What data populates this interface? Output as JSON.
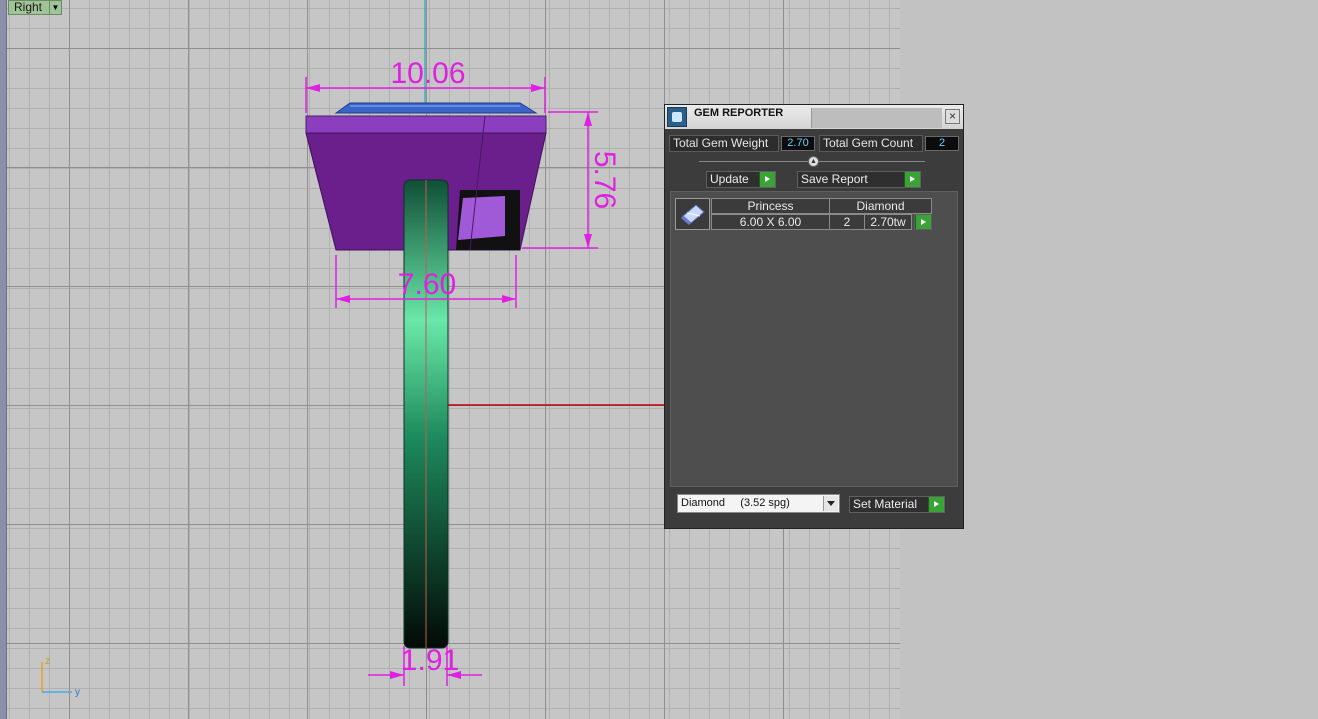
{
  "viewport": {
    "label": "Right",
    "dimensions": {
      "top_width": "10.06",
      "height": "5.76",
      "base_width": "7.60",
      "band_width": "1.91"
    },
    "axes": {
      "vertical": "z",
      "horizontal": "y"
    }
  },
  "gem_reporter": {
    "title": "GEM REPORTER",
    "close": "×",
    "total_weight_label": "Total Gem Weight",
    "total_weight_value": "2.70",
    "total_count_label": "Total Gem Count",
    "total_count_value": "2",
    "update_button": "Update",
    "save_button": "Save Report",
    "gems": [
      {
        "shape": "Princess",
        "material": "Diamond",
        "size": "6.00 X 6.00",
        "count": "2",
        "weight": "2.70tw"
      }
    ],
    "material_select": "Diamond     (3.52 spg)",
    "set_material_button": "Set Material"
  },
  "colors": {
    "dimension": "#e020e0",
    "setting": "#6a1f8c",
    "band": "#1d8a5c",
    "axis_y": "#c00000",
    "axis_z": "#00a0c0"
  }
}
